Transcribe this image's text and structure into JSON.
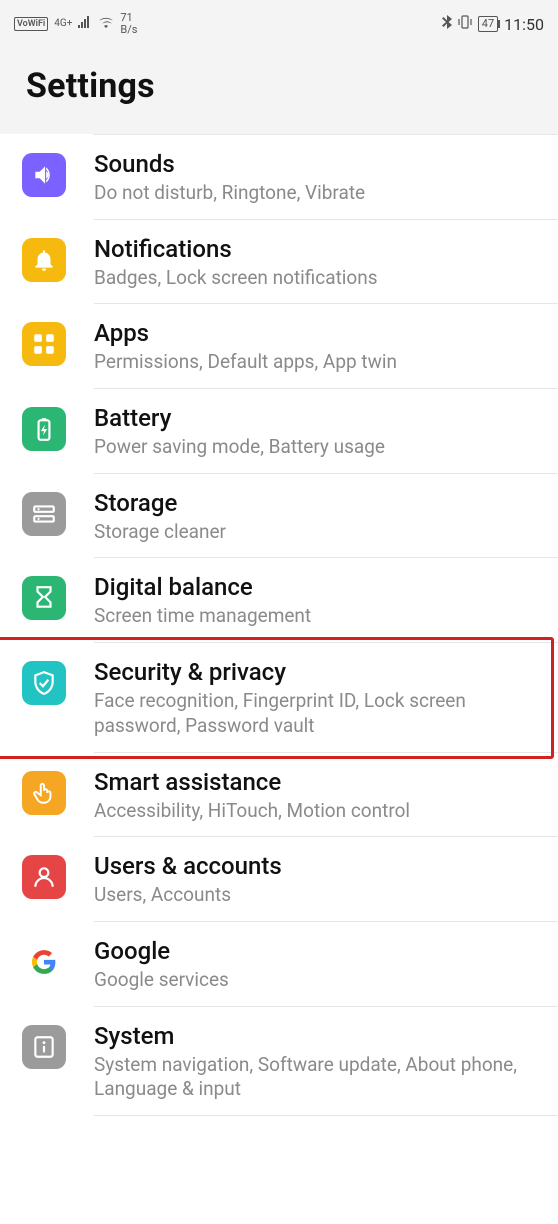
{
  "status": {
    "vowifi": "VoWiFi",
    "net_type": "4G+",
    "speed_value": "71",
    "speed_unit": "B/s",
    "battery": "47",
    "time": "11:50"
  },
  "header": {
    "title": "Settings"
  },
  "items": [
    {
      "title": "Sounds",
      "sub": "Do not disturb, Ringtone, Vibrate",
      "icon": "sound-icon",
      "color": "#7b61ff"
    },
    {
      "title": "Notifications",
      "sub": "Badges, Lock screen notifications",
      "icon": "bell-icon",
      "color": "#f6b90e"
    },
    {
      "title": "Apps",
      "sub": "Permissions, Default apps, App twin",
      "icon": "apps-icon",
      "color": "#f6b90e"
    },
    {
      "title": "Battery",
      "sub": "Power saving mode, Battery usage",
      "icon": "battery-icon",
      "color": "#2bb673"
    },
    {
      "title": "Storage",
      "sub": "Storage cleaner",
      "icon": "storage-icon",
      "color": "#9b9b9b"
    },
    {
      "title": "Digital balance",
      "sub": "Screen time management",
      "icon": "hourglass-icon",
      "color": "#2bb673"
    },
    {
      "title": "Security & privacy",
      "sub": "Face recognition, Fingerprint ID, Lock screen password, Password vault",
      "icon": "shield-icon",
      "color": "#22c3c3"
    },
    {
      "title": "Smart assistance",
      "sub": "Accessibility, HiTouch, Motion control",
      "icon": "hand-icon",
      "color": "#f5a623"
    },
    {
      "title": "Users & accounts",
      "sub": "Users, Accounts",
      "icon": "user-icon",
      "color": "#e64545"
    },
    {
      "title": "Google",
      "sub": "Google services",
      "icon": "google-icon",
      "color": "#ffffff"
    },
    {
      "title": "System",
      "sub": "System navigation, Software update, About phone, Language & input",
      "icon": "info-icon",
      "color": "#9b9b9b"
    }
  ],
  "highlighted_index": 6
}
